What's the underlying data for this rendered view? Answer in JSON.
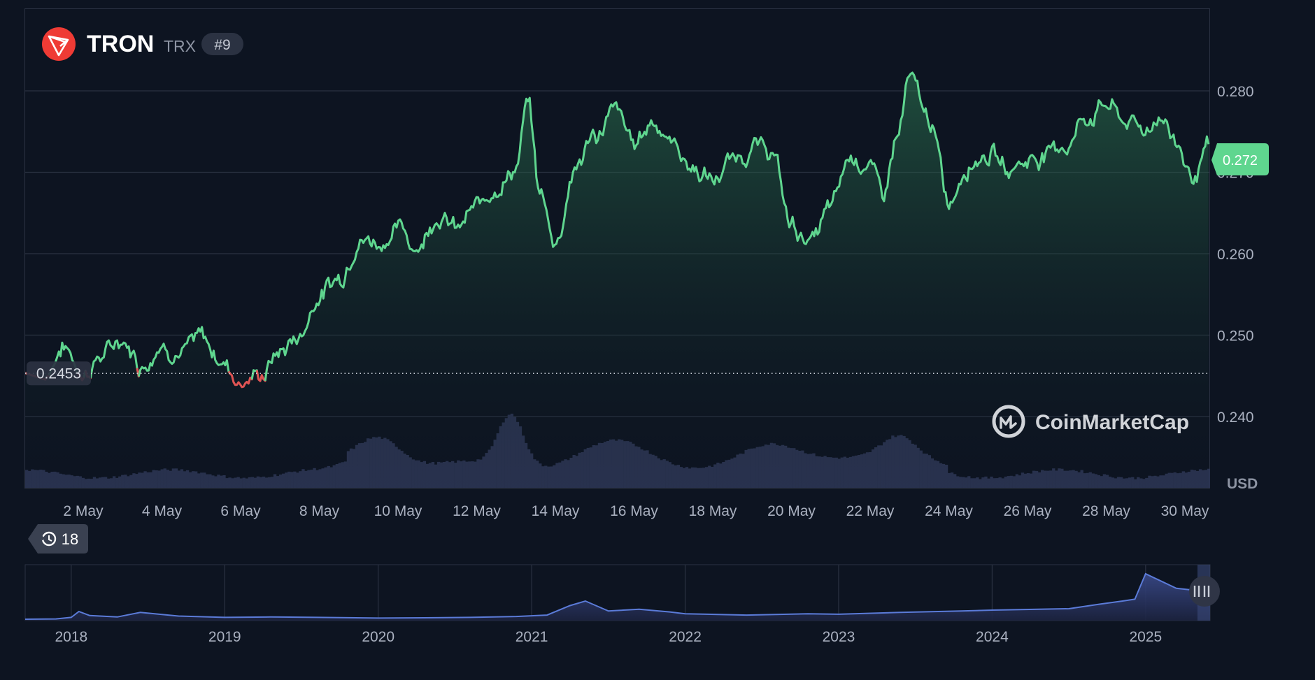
{
  "header": {
    "coin_name": "TRON",
    "symbol": "TRX",
    "rank": "#9",
    "logo_color": "#ef3b35"
  },
  "watermark": "CoinMarketCap",
  "unit_label": "USD",
  "current_price_label": "0.272",
  "open_price_label": "0.2453",
  "history_badge": {
    "icon": "history-icon",
    "count": "18"
  },
  "colors": {
    "background": "#0d1421",
    "up": "#5fd68f",
    "down": "#e05454",
    "grid": "#2b3242",
    "text": "#aab1c0",
    "volume": "#2a3350",
    "navigator": "#5b7bd8"
  },
  "chart_data": [
    {
      "type": "line",
      "x_range": [
        "2 May",
        "30 May"
      ],
      "xticks": [
        "2 May",
        "4 May",
        "6 May",
        "8 May",
        "10 May",
        "12 May",
        "14 May",
        "16 May",
        "18 May",
        "20 May",
        "22 May",
        "24 May",
        "26 May",
        "28 May",
        "30 May"
      ],
      "ylim": [
        0.2365,
        0.2865
      ],
      "yticks": [
        "0.240",
        "0.250",
        "0.260",
        "0.270",
        "0.280"
      ],
      "baseline": 0.2453,
      "grid": true,
      "series": [
        {
          "x": [
            1.0,
            1.5,
            2.0,
            2.5,
            3.0,
            3.5,
            4.0,
            4.5,
            5.0,
            5.5,
            6.0,
            6.5,
            7.0,
            7.5,
            8.0,
            8.5,
            9.0,
            9.5,
            10.0,
            10.5,
            11.0,
            11.5,
            12.0,
            12.5,
            13.0,
            13.3,
            13.6,
            14.0,
            14.5,
            15.0,
            15.5,
            16.0,
            16.5,
            17.0,
            17.5,
            18.0,
            18.5,
            19.0,
            19.5,
            20.0,
            20.5,
            21.0,
            21.5,
            22.0,
            22.3,
            22.7,
            23.0,
            23.5,
            24.0,
            24.5,
            25.0,
            25.5,
            26.0,
            26.5,
            27.0,
            27.5,
            28.0,
            28.5,
            29.0,
            29.4,
            29.8,
            30.2,
            30.6
          ],
          "y": [
            0.2453,
            0.2485,
            0.2455,
            0.2475,
            0.2495,
            0.2465,
            0.249,
            0.248,
            0.2495,
            0.247,
            0.2445,
            0.245,
            0.248,
            0.25,
            0.255,
            0.257,
            0.262,
            0.2615,
            0.263,
            0.261,
            0.265,
            0.263,
            0.2655,
            0.2685,
            0.2705,
            0.2785,
            0.2675,
            0.2615,
            0.2705,
            0.2745,
            0.2775,
            0.2735,
            0.2765,
            0.2735,
            0.2705,
            0.269,
            0.2715,
            0.273,
            0.2725,
            0.2635,
            0.2615,
            0.2655,
            0.272,
            0.271,
            0.267,
            0.2745,
            0.2812,
            0.2765,
            0.2665,
            0.2715,
            0.2725,
            0.2705,
            0.2715,
            0.2725,
            0.2735,
            0.2768,
            0.2785,
            0.2762,
            0.2752,
            0.2772,
            0.2735,
            0.2695,
            0.2725
          ]
        }
      ]
    },
    {
      "type": "area",
      "xticks": [
        "2018",
        "2019",
        "2020",
        "2021",
        "2022",
        "2023",
        "2024",
        "2025"
      ],
      "x_range": [
        2017.7,
        2025.42
      ],
      "series": [
        {
          "x": [
            2017.7,
            2017.9,
            2018.0,
            2018.05,
            2018.12,
            2018.3,
            2018.45,
            2018.7,
            2019.0,
            2019.3,
            2019.6,
            2020.0,
            2020.3,
            2020.6,
            2020.9,
            2021.1,
            2021.25,
            2021.35,
            2021.5,
            2021.7,
            2021.9,
            2022.0,
            2022.4,
            2022.8,
            2023.0,
            2023.4,
            2023.8,
            2024.0,
            2024.15,
            2024.5,
            2024.7,
            2024.85,
            2024.93,
            2025.0,
            2025.2,
            2025.42
          ],
          "y": [
            0.0,
            0.003,
            0.02,
            0.085,
            0.04,
            0.025,
            0.075,
            0.035,
            0.02,
            0.025,
            0.02,
            0.012,
            0.015,
            0.02,
            0.03,
            0.045,
            0.15,
            0.2,
            0.09,
            0.11,
            0.08,
            0.06,
            0.045,
            0.06,
            0.055,
            0.075,
            0.09,
            0.1,
            0.105,
            0.115,
            0.165,
            0.2,
            0.22,
            0.5,
            0.34,
            0.3
          ]
        }
      ]
    }
  ]
}
